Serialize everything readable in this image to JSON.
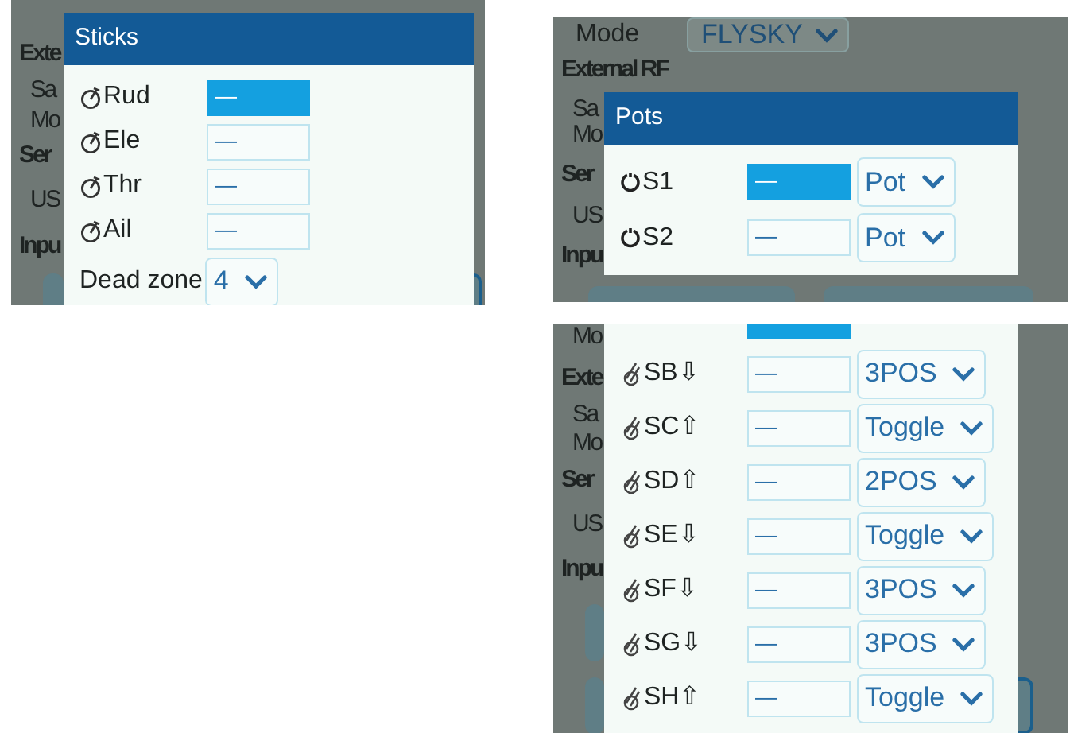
{
  "panels": [
    {
      "title": "Sticks",
      "background": {
        "lines": [
          {
            "text": "Exte",
            "kind": "heading"
          },
          {
            "text": "Sa",
            "kind": "item"
          },
          {
            "text": "Mo",
            "kind": "item"
          },
          {
            "text": "Ser",
            "kind": "heading"
          },
          {
            "text": "US",
            "kind": "item"
          },
          {
            "text": "Inpu",
            "kind": "heading"
          }
        ]
      },
      "rows": [
        {
          "kind": "stick",
          "label": "Rud",
          "value": "—",
          "selected": true
        },
        {
          "kind": "stick",
          "label": "Ele",
          "value": "—",
          "selected": false
        },
        {
          "kind": "stick",
          "label": "Thr",
          "value": "—",
          "selected": false
        },
        {
          "kind": "stick",
          "label": "Ail",
          "value": "—",
          "selected": false
        }
      ],
      "footer": {
        "label": "Dead zone",
        "value": "4"
      }
    },
    {
      "title": "Pots",
      "background": {
        "mode": {
          "label": "Mode",
          "value": "FLYSKY"
        },
        "lines": [
          {
            "text": "External RF",
            "kind": "heading"
          },
          {
            "text": "Sa",
            "kind": "item"
          },
          {
            "text": "Mo",
            "kind": "item"
          },
          {
            "text": "Ser",
            "kind": "heading"
          },
          {
            "text": "US",
            "kind": "item"
          },
          {
            "text": "Inpu",
            "kind": "heading"
          }
        ]
      },
      "rows": [
        {
          "kind": "pot",
          "label": "S1",
          "value": "—",
          "selected": true,
          "type": "Pot"
        },
        {
          "kind": "pot",
          "label": "S2",
          "value": "—",
          "selected": false,
          "type": "Pot"
        }
      ]
    },
    {
      "background": {
        "lines": [
          {
            "text": "Mo",
            "kind": "item"
          },
          {
            "text": "Exte",
            "kind": "heading"
          },
          {
            "text": "Sa",
            "kind": "item"
          },
          {
            "text": "Mo",
            "kind": "item"
          },
          {
            "text": "Ser",
            "kind": "heading"
          },
          {
            "text": "US",
            "kind": "item"
          },
          {
            "text": "Inpu",
            "kind": "heading"
          }
        ]
      },
      "rows": [
        {
          "selected": true
        },
        {
          "kind": "switch",
          "label": "SB⇩",
          "value": "—",
          "selected": false,
          "type": "3POS"
        },
        {
          "kind": "switch",
          "label": "SC⇧",
          "value": "—",
          "selected": false,
          "type": "Toggle"
        },
        {
          "kind": "switch",
          "label": "SD⇧",
          "value": "—",
          "selected": false,
          "type": "2POS"
        },
        {
          "kind": "switch",
          "label": "SE⇩",
          "value": "—",
          "selected": false,
          "type": "Toggle"
        },
        {
          "kind": "switch",
          "label": "SF⇩",
          "value": "—",
          "selected": false,
          "type": "3POS"
        },
        {
          "kind": "switch",
          "label": "SG⇩",
          "value": "—",
          "selected": false,
          "type": "3POS"
        },
        {
          "kind": "switch",
          "label": "SH⇧",
          "value": "—",
          "selected": false,
          "type": "Toggle"
        }
      ]
    }
  ]
}
